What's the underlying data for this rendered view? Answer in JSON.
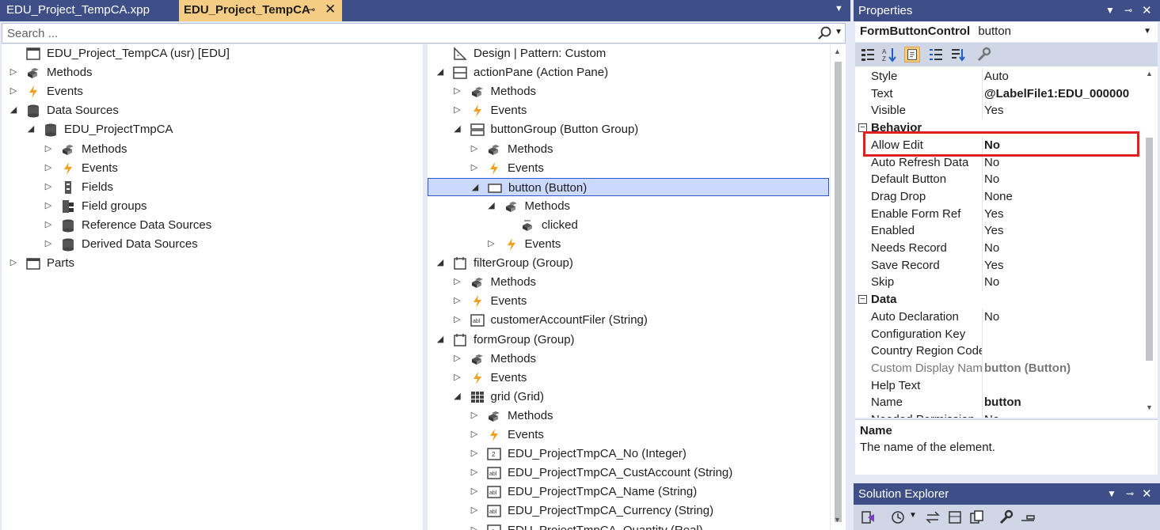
{
  "tabs": {
    "inactive": "EDU_Project_TempCA.xpp",
    "active": "EDU_Project_TempCA",
    "pin": "⊸",
    "close": "✕"
  },
  "search": {
    "placeholder": "Search ..."
  },
  "left_tree": [
    {
      "label": "EDU_Project_TempCA (usr) [EDU]",
      "icon": "form-window-icon",
      "depth": 0,
      "arrow": ""
    },
    {
      "label": "Methods",
      "icon": "methods-icon",
      "depth": 0,
      "arrow": "right"
    },
    {
      "label": "Events",
      "icon": "events-icon",
      "depth": 0,
      "arrow": "right"
    },
    {
      "label": "Data Sources",
      "icon": "database-icon",
      "depth": 0,
      "arrow": "down"
    },
    {
      "label": "EDU_ProjectTmpCA",
      "icon": "database-icon",
      "depth": 1,
      "arrow": "down"
    },
    {
      "label": "Methods",
      "icon": "methods-icon",
      "depth": 2,
      "arrow": "right"
    },
    {
      "label": "Events",
      "icon": "events-icon",
      "depth": 2,
      "arrow": "right"
    },
    {
      "label": "Fields",
      "icon": "fields-icon",
      "depth": 2,
      "arrow": "right"
    },
    {
      "label": "Field groups",
      "icon": "field-groups-icon",
      "depth": 2,
      "arrow": "right"
    },
    {
      "label": "Reference Data Sources",
      "icon": "database-icon",
      "depth": 2,
      "arrow": "right"
    },
    {
      "label": "Derived Data Sources",
      "icon": "database-icon",
      "depth": 2,
      "arrow": "right"
    },
    {
      "label": "Parts",
      "icon": "parts-icon",
      "depth": 0,
      "arrow": "right"
    }
  ],
  "mid_tree": [
    {
      "label": "Design | Pattern: Custom",
      "icon": "design-icon",
      "depth": 0,
      "arrow": ""
    },
    {
      "label": "actionPane (Action Pane)",
      "icon": "action-pane-icon",
      "depth": 0,
      "arrow": "down"
    },
    {
      "label": "Methods",
      "icon": "methods-icon",
      "depth": 1,
      "arrow": "right"
    },
    {
      "label": "Events",
      "icon": "events-icon",
      "depth": 1,
      "arrow": "right"
    },
    {
      "label": "buttonGroup (Button Group)",
      "icon": "button-group-icon",
      "depth": 1,
      "arrow": "down"
    },
    {
      "label": "Methods",
      "icon": "methods-icon",
      "depth": 2,
      "arrow": "right"
    },
    {
      "label": "Events",
      "icon": "events-icon",
      "depth": 2,
      "arrow": "right"
    },
    {
      "label": "button (Button)",
      "icon": "button-icon",
      "depth": 2,
      "arrow": "down",
      "selected": true
    },
    {
      "label": "Methods",
      "icon": "methods-icon",
      "depth": 3,
      "arrow": "down"
    },
    {
      "label": "clicked",
      "icon": "method-icon",
      "depth": 4,
      "arrow": ""
    },
    {
      "label": "Events",
      "icon": "events-icon",
      "depth": 3,
      "arrow": "right"
    },
    {
      "label": "filterGroup (Group)",
      "icon": "group-icon",
      "depth": 0,
      "arrow": "down"
    },
    {
      "label": "Methods",
      "icon": "methods-icon",
      "depth": 1,
      "arrow": "right"
    },
    {
      "label": "Events",
      "icon": "events-icon",
      "depth": 1,
      "arrow": "right"
    },
    {
      "label": "customerAccountFiler (String)",
      "icon": "string-icon",
      "depth": 1,
      "arrow": "right"
    },
    {
      "label": "formGroup (Group)",
      "icon": "group-icon",
      "depth": 0,
      "arrow": "down"
    },
    {
      "label": "Methods",
      "icon": "methods-icon",
      "depth": 1,
      "arrow": "right"
    },
    {
      "label": "Events",
      "icon": "events-icon",
      "depth": 1,
      "arrow": "right"
    },
    {
      "label": "grid (Grid)",
      "icon": "grid-icon",
      "depth": 1,
      "arrow": "down"
    },
    {
      "label": "Methods",
      "icon": "methods-icon",
      "depth": 2,
      "arrow": "right"
    },
    {
      "label": "Events",
      "icon": "events-icon",
      "depth": 2,
      "arrow": "right"
    },
    {
      "label": "EDU_ProjectTmpCA_No (Integer)",
      "icon": "integer-icon",
      "depth": 2,
      "arrow": "right"
    },
    {
      "label": "EDU_ProjectTmpCA_CustAccount (String)",
      "icon": "string-icon",
      "depth": 2,
      "arrow": "right"
    },
    {
      "label": "EDU_ProjectTmpCA_Name (String)",
      "icon": "string-icon",
      "depth": 2,
      "arrow": "right"
    },
    {
      "label": "EDU_ProjectTmpCA_Currency (String)",
      "icon": "string-icon",
      "depth": 2,
      "arrow": "right"
    },
    {
      "label": "EDU_ProjectTmpCA_Quantity (Real)",
      "icon": "real-icon",
      "depth": 2,
      "arrow": "right"
    }
  ],
  "properties": {
    "title": "Properties",
    "object_type": "FormButtonControl",
    "object_name": "button",
    "rows": [
      {
        "name": "Style",
        "value": "Auto"
      },
      {
        "name": "Text",
        "value": "@LabelFile1:EDU_000000",
        "bold": true
      },
      {
        "name": "Visible",
        "value": "Yes"
      },
      {
        "name": "Behavior",
        "category": true
      },
      {
        "name": "Allow Edit",
        "value": "No",
        "bold": true
      },
      {
        "name": "Auto Refresh Data",
        "value": "No"
      },
      {
        "name": "Default Button",
        "value": "No"
      },
      {
        "name": "Drag Drop",
        "value": "None"
      },
      {
        "name": "Enable Form Ref",
        "value": "Yes"
      },
      {
        "name": "Enabled",
        "value": "Yes"
      },
      {
        "name": "Needs Record",
        "value": "No"
      },
      {
        "name": "Save Record",
        "value": "Yes"
      },
      {
        "name": "Skip",
        "value": "No"
      },
      {
        "name": "Data",
        "category": true
      },
      {
        "name": "Auto Declaration",
        "value": "No"
      },
      {
        "name": "Configuration Key",
        "value": ""
      },
      {
        "name": "Country Region Codes",
        "value": ""
      },
      {
        "name": "Custom Display Name",
        "value": "button (Button)",
        "bold": true,
        "gray": true
      },
      {
        "name": "Help Text",
        "value": ""
      },
      {
        "name": "Name",
        "value": "button",
        "bold": true
      },
      {
        "name": "Needed Permission",
        "value": "No"
      }
    ],
    "description_name": "Name",
    "description_text": "The name of the element."
  },
  "solution_explorer": {
    "title": "Solution Explorer"
  },
  "colors": {
    "title_bar": "#3e4e87",
    "active_tab": "#f5cc84",
    "selection": "#ccd9ff",
    "highlight_box": "#e02020"
  }
}
